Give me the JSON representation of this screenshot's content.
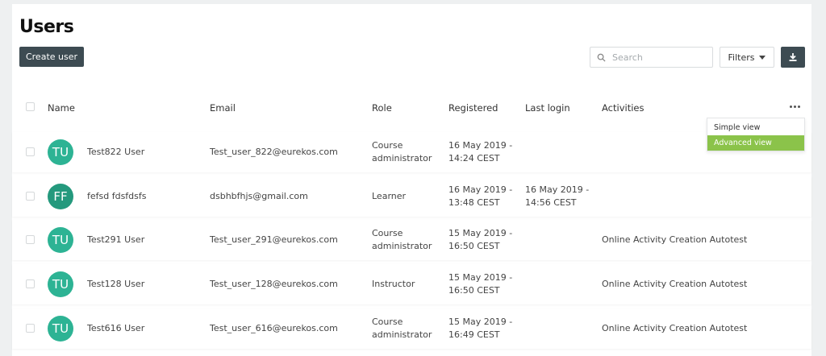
{
  "header": {
    "title": "Users",
    "create_label": "Create user",
    "search_placeholder": "Search",
    "filters_label": "Filters"
  },
  "icons": {
    "search": "search-icon",
    "download": "download-icon",
    "more": "more-dots-icon",
    "filters_caret": "caret-down-icon"
  },
  "table": {
    "columns": [
      "Name",
      "Email",
      "Role",
      "Registered",
      "Last login",
      "Activities"
    ],
    "rows": [
      {
        "initials": "TU",
        "avatar_color": "#2db394",
        "name": "Test822 User",
        "email": "Test_user_822@eurekos.com",
        "role": [
          "Course",
          "administrator"
        ],
        "registered": [
          "16 May 2019 -",
          "14:24 CEST"
        ],
        "last_login": [
          "",
          ""
        ],
        "activities": ""
      },
      {
        "initials": "FF",
        "avatar_color": "#24997d",
        "name": "fefsd fdsfdsfs",
        "email": "dsbhbfhjs@gmail.com",
        "role": [
          "Learner",
          ""
        ],
        "registered": [
          "16 May 2019 -",
          "13:48 CEST"
        ],
        "last_login": [
          "16 May 2019 -",
          "14:56 CEST"
        ],
        "activities": ""
      },
      {
        "initials": "TU",
        "avatar_color": "#2db394",
        "name": "Test291 User",
        "email": "Test_user_291@eurekos.com",
        "role": [
          "Course",
          "administrator"
        ],
        "registered": [
          "15 May 2019 -",
          "16:50 CEST"
        ],
        "last_login": [
          "",
          ""
        ],
        "activities": "Online Activity Creation Autotest"
      },
      {
        "initials": "TU",
        "avatar_color": "#2db394",
        "name": "Test128 User",
        "email": "Test_user_128@eurekos.com",
        "role": [
          "Instructor",
          ""
        ],
        "registered": [
          "15 May 2019 -",
          "16:50 CEST"
        ],
        "last_login": [
          "",
          ""
        ],
        "activities": "Online Activity Creation Autotest"
      },
      {
        "initials": "TU",
        "avatar_color": "#2db394",
        "name": "Test616 User",
        "email": "Test_user_616@eurekos.com",
        "role": [
          "Course",
          "administrator"
        ],
        "registered": [
          "15 May 2019 -",
          "16:49 CEST"
        ],
        "last_login": [
          "",
          ""
        ],
        "activities": "Online Activity Creation Autotest"
      }
    ]
  },
  "view_menu": {
    "items": [
      "Simple view",
      "Advanced view"
    ],
    "selected": "Advanced view",
    "selected_color": "#8bc34a"
  },
  "colors": {
    "dark_button": "#3d4b52",
    "accent_green": "#8bc34a"
  }
}
